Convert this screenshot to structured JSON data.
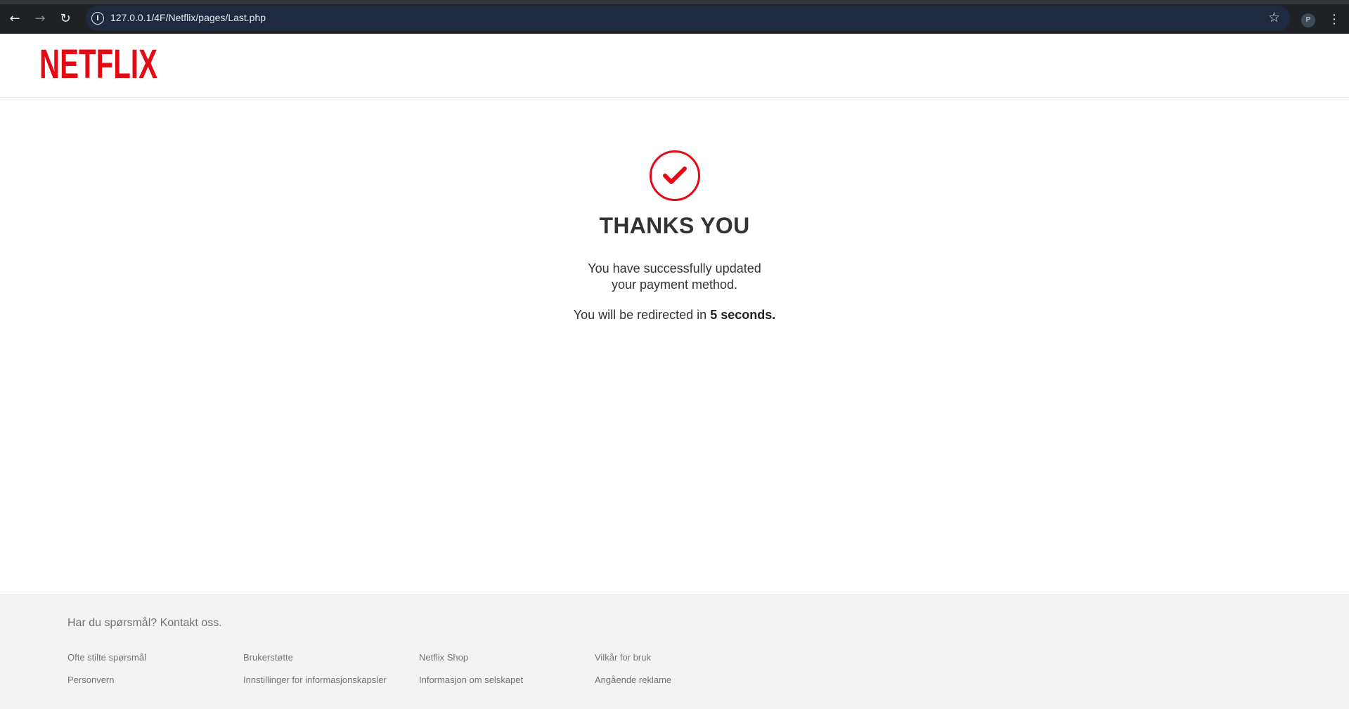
{
  "browser": {
    "url": "127.0.0.1/4F/Netflix/pages/Last.php",
    "profile_initial": "P"
  },
  "header": {
    "logo_text": "NETFLIX",
    "brand_color": "#e50914"
  },
  "main": {
    "title": "THANKS YOU",
    "message_line1": "You have successfully updated",
    "message_line2": "your payment method.",
    "redirect_prefix": "You will be redirected in",
    "redirect_time": "5 seconds."
  },
  "footer": {
    "contact": "Har du spørsmål? Kontakt oss.",
    "links": [
      "Ofte stilte spørsmål",
      "Brukerstøtte",
      "Netflix Shop",
      "Vilkår for bruk",
      "Personvern",
      "Innstillinger for informasjonskapsler",
      "Informasjon om selskapet",
      "Angående reklame"
    ]
  }
}
